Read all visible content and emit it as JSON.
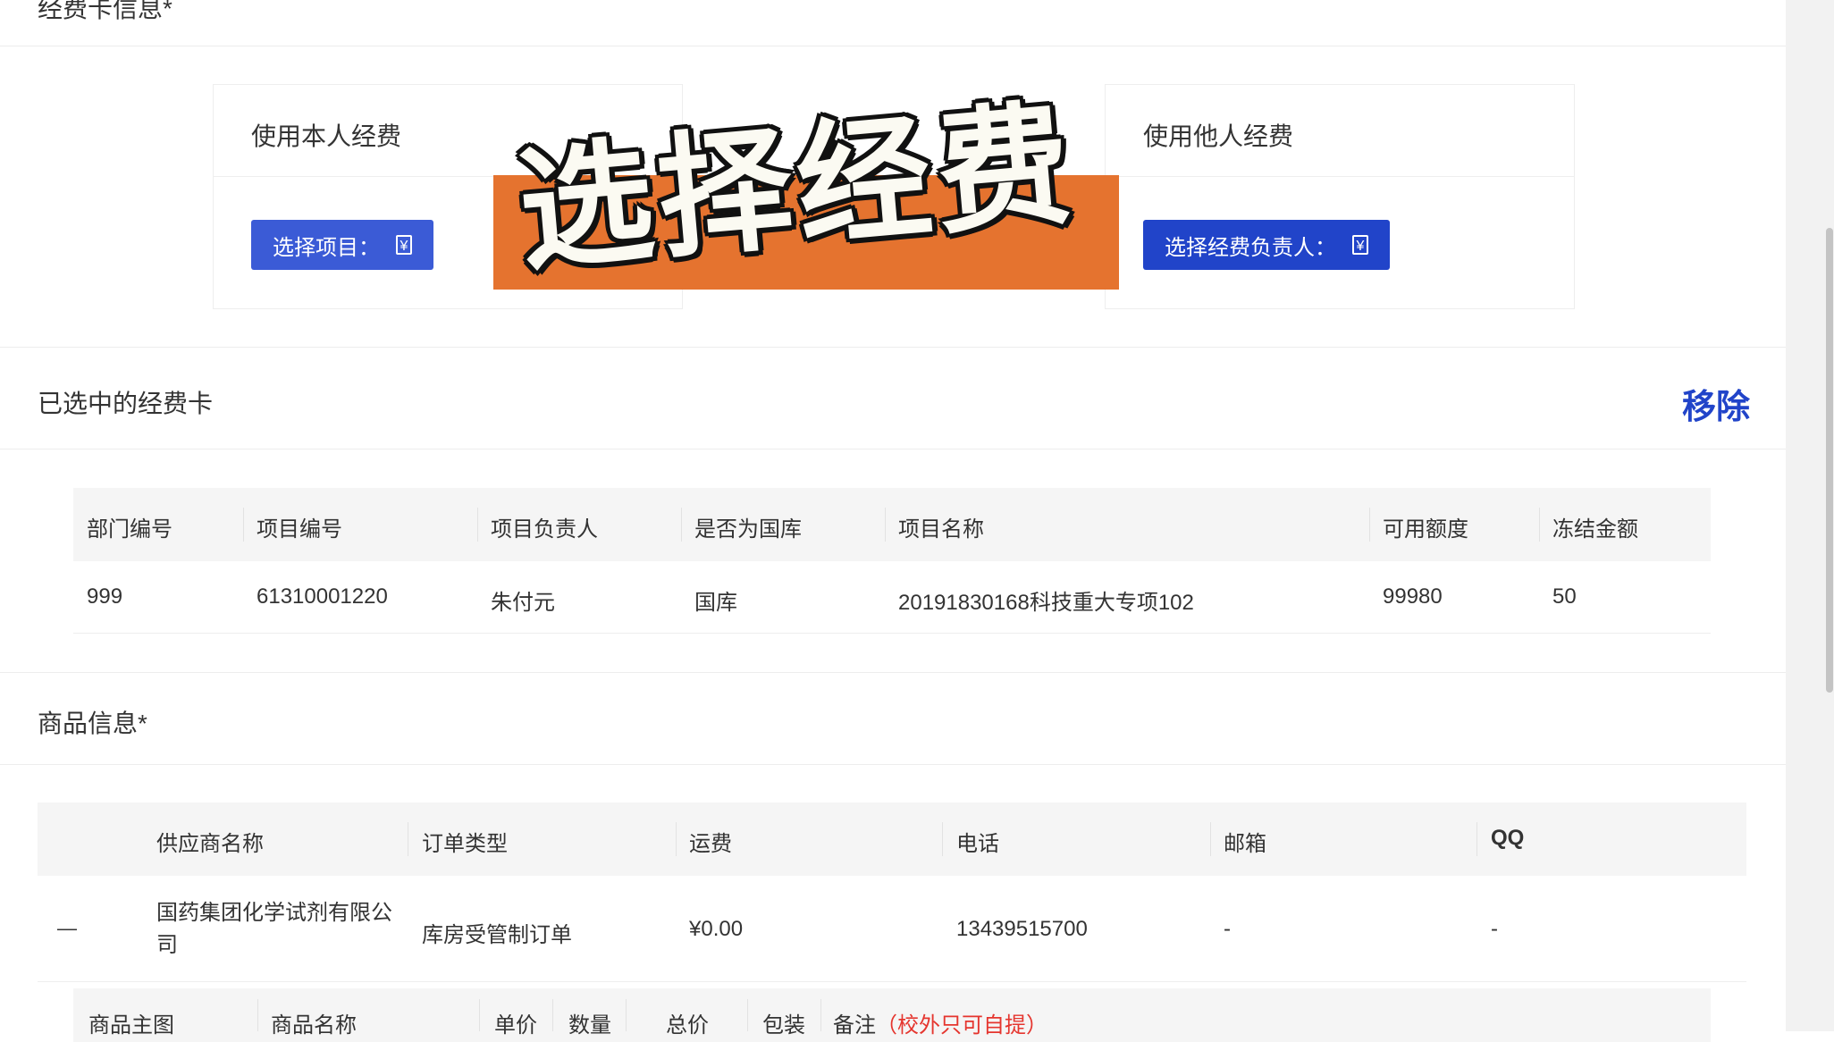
{
  "sections": {
    "card_info_title": "经费卡信息*",
    "selected_title": "已选中的经费卡",
    "goods_title": "商品信息*"
  },
  "cards": {
    "own": {
      "title": "使用本人经费",
      "button_label": "选择项目：",
      "button_icon": "¥"
    },
    "other": {
      "title": "使用他人经费",
      "button_label": "选择经费负责人：",
      "button_icon": "¥"
    }
  },
  "overlay": {
    "text": "选择经费",
    "background": "#e5732f"
  },
  "remove_label": "移除",
  "fund_table": {
    "headers": [
      "部门编号",
      "项目编号",
      "项目负责人",
      "是否为国库",
      "项目名称",
      "可用额度",
      "冻结金额"
    ],
    "rows": [
      [
        "999",
        "61310001220",
        "朱付元",
        "国库",
        "20191830168科技重大专项102",
        "99980",
        "50"
      ]
    ]
  },
  "supplier_table": {
    "headers": [
      "供应商名称",
      "订单类型",
      "运费",
      "电话",
      "邮箱",
      "QQ"
    ],
    "rows": [
      [
        "国药集团化学试剂有限公司",
        "库房受管制订单",
        "¥0.00",
        "13439515700",
        "-",
        "-"
      ]
    ],
    "collapse_symbol": "—"
  },
  "goods_table": {
    "headers": [
      "商品主图",
      "商品名称",
      "单价",
      "数量",
      "总价",
      "包装",
      "备注"
    ],
    "note_hint": "（校外只可自提）"
  },
  "colors": {
    "primary": "#2144c9",
    "primary_light": "#3b5bd6",
    "danger": "#e5352e"
  }
}
